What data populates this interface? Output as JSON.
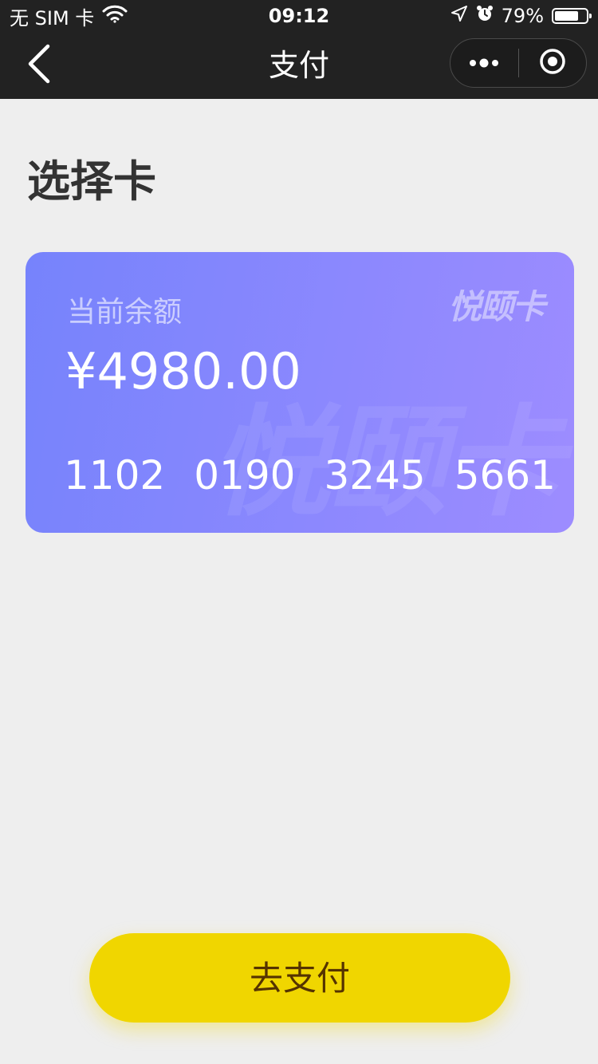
{
  "status_bar": {
    "carrier": "无 SIM 卡",
    "time": "09:12",
    "battery": "79%",
    "battery_level": 0.79,
    "icons": [
      "wifi-icon",
      "location-arrow-icon",
      "alarm-icon",
      "battery-icon"
    ]
  },
  "nav": {
    "title": "支付",
    "icons": [
      "back-chevron-icon",
      "more-dots-icon",
      "close-target-icon"
    ]
  },
  "page": {
    "section_title": "选择卡"
  },
  "card": {
    "brand": "悦颐卡",
    "watermark": "悦颐卡",
    "balance_label": "当前余额",
    "balance": "¥4980.00",
    "number_groups": [
      "1102",
      "0190",
      "3245",
      "5661"
    ],
    "gradient_start": "#7683fc",
    "gradient_end": "#9d8cff"
  },
  "actions": {
    "pay_label": "去支付",
    "pay_color": "#f0d600"
  }
}
